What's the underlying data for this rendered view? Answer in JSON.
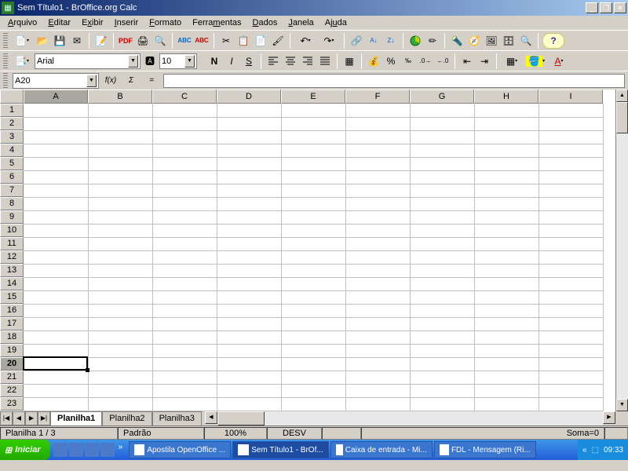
{
  "window": {
    "title": "Sem Título1 - BrOffice.org Calc"
  },
  "menu": {
    "items": [
      "Arquivo",
      "Editar",
      "Exibir",
      "Inserir",
      "Formato",
      "Ferramentas",
      "Dados",
      "Janela",
      "Ajuda"
    ]
  },
  "format": {
    "font": "Arial",
    "size": "10"
  },
  "namebox": {
    "value": "A20"
  },
  "fx": {
    "wizard": "f(x)",
    "sum": "Σ",
    "eq": "="
  },
  "columns": [
    "A",
    "B",
    "C",
    "D",
    "E",
    "F",
    "G",
    "H",
    "I"
  ],
  "rows": [
    "1",
    "2",
    "3",
    "4",
    "5",
    "6",
    "7",
    "8",
    "9",
    "10",
    "11",
    "12",
    "13",
    "14",
    "15",
    "16",
    "17",
    "18",
    "19",
    "20",
    "21",
    "22",
    "23"
  ],
  "active": {
    "col": "A",
    "row": "20"
  },
  "tabs": {
    "nav": [
      "|◀",
      "◀",
      "▶",
      "▶|"
    ],
    "sheets": [
      "Planilha1",
      "Planilha2",
      "Planilha3"
    ],
    "active": 0
  },
  "status": {
    "sheet": "Planilha 1 / 3",
    "style": "Padrão",
    "zoom": "100%",
    "mode": "DESV",
    "sum": "Soma=0"
  },
  "taskbar": {
    "start": "Iniciar",
    "tasks": [
      {
        "label": "Apostila OpenOffice ...",
        "active": false
      },
      {
        "label": "Sem Título1 - BrOf...",
        "active": true
      },
      {
        "label": "Caixa de entrada - Mi...",
        "active": false
      },
      {
        "label": "FDL - Mensagem (Ri...",
        "active": false
      }
    ],
    "clock": "09:33"
  }
}
